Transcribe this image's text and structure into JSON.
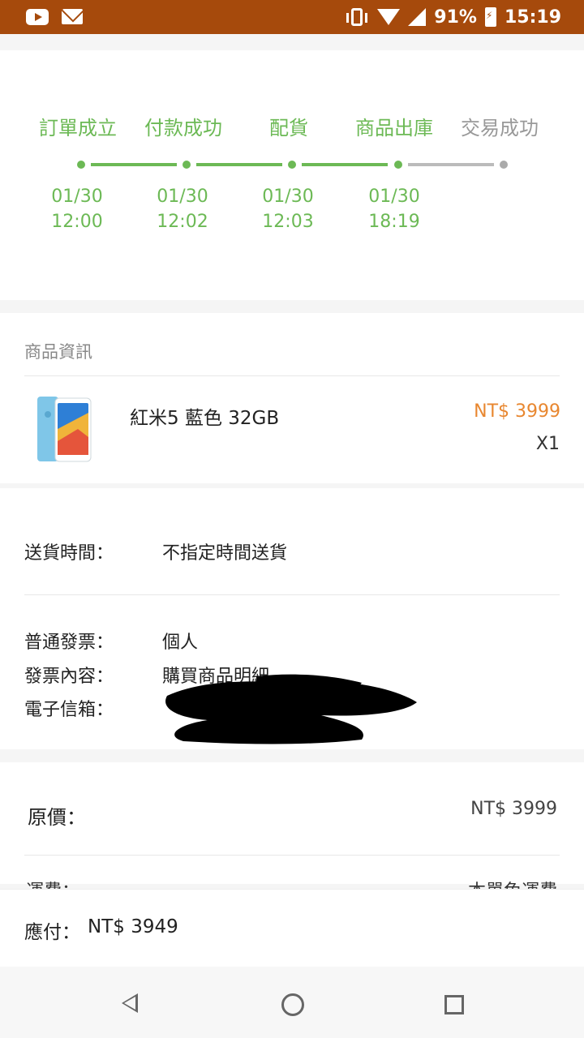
{
  "status_bar": {
    "battery": "91%",
    "time": "15:19"
  },
  "tracker": {
    "steps": [
      {
        "label": "訂單成立",
        "date": "01/30",
        "time": "12:00",
        "done": true
      },
      {
        "label": "付款成功",
        "date": "01/30",
        "time": "12:02",
        "done": true
      },
      {
        "label": "配貨",
        "date": "01/30",
        "time": "12:03",
        "done": true
      },
      {
        "label": "商品出庫",
        "date": "01/30",
        "time": "18:19",
        "done": true
      },
      {
        "label": "交易成功",
        "done": false
      }
    ],
    "colors": {
      "done": "#6cb955",
      "pending": "#aaaaaa"
    }
  },
  "product_section": {
    "title": "商品資訊",
    "item": {
      "name": "紅米5 藍色 32GB",
      "price": "NT$ 3999",
      "quantity": "X1"
    },
    "price_color": "#e88730"
  },
  "delivery": {
    "label": "送貨時間：",
    "value": "不指定時間送貨"
  },
  "invoice": {
    "type_label": "普通發票：",
    "type_value": "個人",
    "content_label": "發票內容：",
    "content_value": "購買商品明細",
    "email_label": "電子信箱："
  },
  "price_summary": {
    "original_label": "原價：",
    "original_value": "NT$ 3999",
    "shipping_label": "運費：",
    "shipping_value": "本單免運費"
  },
  "payment": {
    "label": "應付：",
    "value": "NT$ 3949"
  },
  "theme": {
    "status_bar_color": "#a64a0c"
  }
}
